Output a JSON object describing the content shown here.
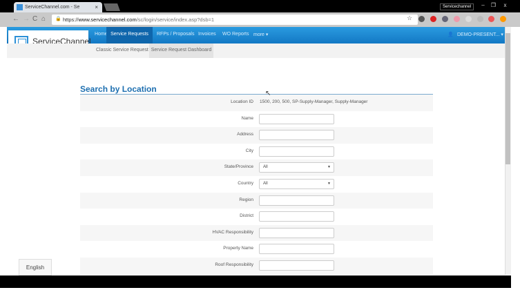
{
  "browser": {
    "tab_title": "ServiceChannel.com - Se",
    "profile": "Servicechannel",
    "url_scheme": "https://",
    "url_domain": "www.servicechannel.com",
    "url_path": "/sc/login/service/index.asp?dsb=1"
  },
  "app": {
    "logo": "ServiceChannel",
    "nav": [
      "Home",
      "Service Requests",
      "RFPs / Proposals",
      "Invoices",
      "WO Reports",
      "more"
    ],
    "user": "DEMO-PRESENT...",
    "subnav": [
      "Classic Service Request",
      "Service Request Dashboard"
    ]
  },
  "form": {
    "title": "Search by Location",
    "location_id_label": "Location ID",
    "location_id_value": "1500, 200, 500, SP-Supply-Manager, Supply-Manager",
    "fields": [
      {
        "label": "Name"
      },
      {
        "label": "Address"
      },
      {
        "label": "City"
      },
      {
        "label": "State/Province",
        "value": "All"
      },
      {
        "label": "Country",
        "value": "All"
      },
      {
        "label": "Region"
      },
      {
        "label": "District"
      },
      {
        "label": "HVAC Responsibility"
      },
      {
        "label": "Property Name"
      },
      {
        "label": "Roof Responsibility"
      }
    ]
  },
  "language": "English"
}
